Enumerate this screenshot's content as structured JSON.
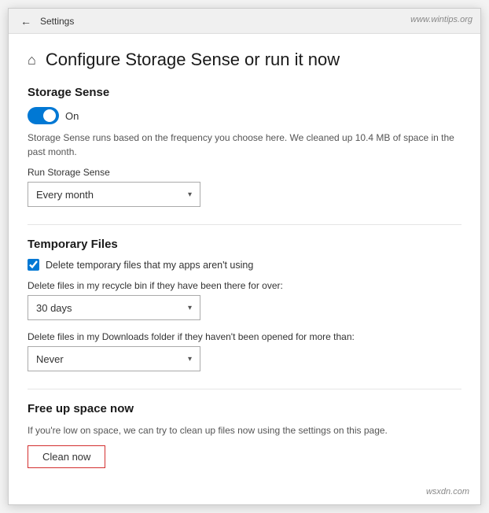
{
  "titlebar": {
    "title": "Settings"
  },
  "watermark": "www.wintips.org",
  "wsxdn": "wsxdn.com",
  "page": {
    "title": "Configure Storage Sense or run it now"
  },
  "storageSense": {
    "sectionTitle": "Storage Sense",
    "toggleLabel": "On",
    "description": "Storage Sense runs based on the frequency you choose here. We cleaned up 10.4 MB of space in the past month.",
    "runLabel": "Run Storage Sense",
    "runValue": "Every month"
  },
  "temporaryFiles": {
    "sectionTitle": "Temporary Files",
    "checkboxLabel": "Delete temporary files that my apps aren't using",
    "recycleLabel": "Delete files in my recycle bin if they have been there for over:",
    "recycleValue": "30 days",
    "downloadsLabel": "Delete files in my Downloads folder if they haven't been opened for more than:",
    "downloadsValue": "Never"
  },
  "freeUpSpace": {
    "sectionTitle": "Free up space now",
    "description": "If you're low on space, we can try to clean up files now using the settings on this page.",
    "buttonLabel": "Clean now"
  },
  "dropdownArrow": "▾"
}
